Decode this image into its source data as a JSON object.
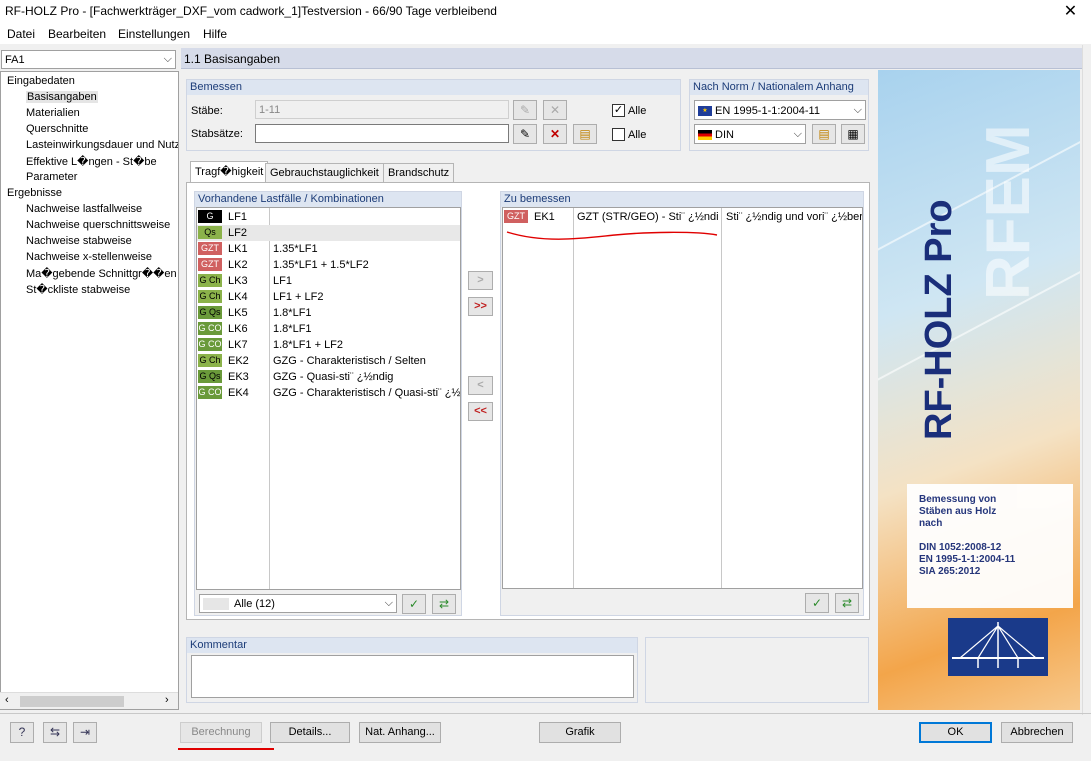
{
  "window": {
    "title": "RF-HOLZ Pro - [Fachwerkträger_DXF_vom cadwork_1]Testversion - 66/90 Tage verbleibend",
    "close_glyph": "✕"
  },
  "menu": [
    "Datei",
    "Bearbeiten",
    "Einstellungen",
    "Hilfe"
  ],
  "case_select": "FA1",
  "tree": {
    "input_root": "Eingabedaten",
    "input_items": [
      "Basisangaben",
      "Materialien",
      "Querschnitte",
      "Lasteinwirkungsdauer und Nutz",
      "Effektive L�ngen - St�be",
      "Parameter"
    ],
    "results_root": "Ergebnisse",
    "result_items": [
      "Nachweise lastfallweise",
      "Nachweise querschnittsweise",
      "Nachweise stabweise",
      "Nachweise x-stellenweise",
      "Ma�gebende Schnittgr��en",
      "St�ckliste stabweise"
    ]
  },
  "page_title": "1.1 Basisangaben",
  "design": {
    "header": "Bemessen",
    "members_label": "Stäbe:",
    "members_value": "1-11",
    "sets_label": "Stabsätze:",
    "sets_value": "",
    "all_label": "Alle",
    "all_members_checked": true,
    "all_sets_checked": false
  },
  "norm": {
    "header": "Nach Norm / Nationalem Anhang",
    "standard": "EN 1995-1-1:2004-11",
    "annex": "DIN"
  },
  "tabs": [
    "Tragf�higkeit",
    "Gebrauchstauglichkeit",
    "Brandschutz"
  ],
  "available": {
    "header": "Vorhandene Lastfälle / Kombinationen",
    "rows": [
      {
        "badge": "G",
        "id": "LF1",
        "desc": "",
        "color": "#000000",
        "text_color": "#ffffff"
      },
      {
        "badge": "Qs",
        "id": "LF2",
        "desc": "",
        "color": "#8bb24a",
        "text_color": "#000000"
      },
      {
        "badge": "GZT",
        "id": "LK1",
        "desc": "1.35*LF1",
        "color": "#d06060",
        "text_color": "#ffffff"
      },
      {
        "badge": "GZT",
        "id": "LK2",
        "desc": "1.35*LF1 + 1.5*LF2",
        "color": "#d06060",
        "text_color": "#ffffff"
      },
      {
        "badge": "G Ch",
        "id": "LK3",
        "desc": "LF1",
        "color": "#8bb24a",
        "text_color": "#000000"
      },
      {
        "badge": "G Ch",
        "id": "LK4",
        "desc": "LF1 + LF2",
        "color": "#8bb24a",
        "text_color": "#000000"
      },
      {
        "badge": "G Qs",
        "id": "LK5",
        "desc": "1.8*LF1",
        "color": "#6a9a3a",
        "text_color": "#000000"
      },
      {
        "badge": "G CO",
        "id": "LK6",
        "desc": "1.8*LF1",
        "color": "#6a9a3a",
        "text_color": "#ffffff"
      },
      {
        "badge": "G CO",
        "id": "LK7",
        "desc": "1.8*LF1 + LF2",
        "color": "#6a9a3a",
        "text_color": "#ffffff"
      },
      {
        "badge": "G Ch",
        "id": "EK2",
        "desc": "GZG - Charakteristisch / Selten",
        "color": "#8bb24a",
        "text_color": "#000000"
      },
      {
        "badge": "G Qs",
        "id": "EK3",
        "desc": "GZG - Quasi-sti¨ ¿½ndig",
        "color": "#6a9a3a",
        "text_color": "#000000"
      },
      {
        "badge": "G CO",
        "id": "EK4",
        "desc": "GZG - Charakteristisch / Quasi-sti¨ ¿½",
        "color": "#6a9a3a",
        "text_color": "#ffffff"
      }
    ],
    "filter": "Alle (12)"
  },
  "to_design": {
    "header": "Zu bemessen",
    "rows": [
      {
        "badge": "GZT",
        "id": "EK1",
        "desc": "GZT (STR/GEO) - Sti¨ ¿½ndi",
        "extra": "Sti¨ ¿½ndig und vori¨ ¿½berg",
        "color": "#d06060"
      }
    ]
  },
  "comment": {
    "header": "Kommentar",
    "value": ""
  },
  "banner": {
    "product": "RF-HOLZ Pro",
    "watermark": "RFEM",
    "text_lines": [
      "Bemessung von",
      "Stäben aus Holz",
      "nach"
    ],
    "norms": [
      "DIN 1052:2008-12",
      "EN 1995-1-1:2004-11",
      "SIA 265:2012"
    ]
  },
  "footer": {
    "calc": "Berechnung",
    "details": "Details...",
    "annex": "Nat. Anhang...",
    "graphic": "Grafik",
    "ok": "OK",
    "cancel": "Abbrechen"
  }
}
